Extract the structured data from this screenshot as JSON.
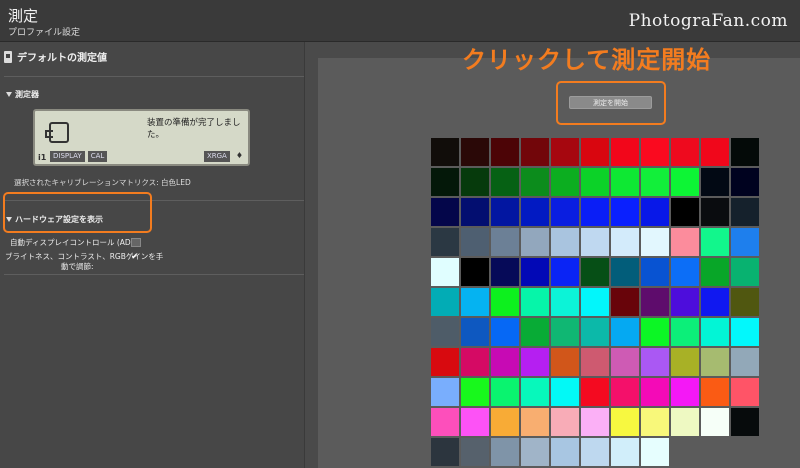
{
  "window": {
    "title": "測定",
    "subtitle": "プロファイル設定"
  },
  "watermark": "PhotograFan.com",
  "sidebar": {
    "header": "デフォルトの測定値",
    "instrument_heading": "測定器",
    "lcd_message": "装置の準備が完了しました。",
    "lcd_tags": [
      "DISPLAY",
      "CAL",
      "XRGA"
    ],
    "lcd_brand": "i1",
    "matrix_label": "選択されたキャリブレーションマトリクス:",
    "matrix_value": "白色LED",
    "hardware_heading": "ハードウェア設定を表示",
    "adc_label": "自動ディスプレイコントロール (ADC):",
    "adc_checked": false,
    "rgb_label_1": "ブライトネス、コントラスト、RGBゲインを手",
    "rgb_label_2": "動で調節:",
    "rgb_checked": true
  },
  "main": {
    "callout": "クリックして測定開始",
    "start_button": "測定を開始"
  },
  "swatches": [
    [
      "#110d0a",
      "#2a0807",
      "#4c0406",
      "#72060a",
      "#a6070f",
      "#d9060f",
      "#f2061a",
      "#fa0a1f",
      "#ee0a1e",
      "#f0071b",
      "#040a08"
    ],
    [
      "#041809",
      "#063a0c",
      "#066114",
      "#0c8c1c",
      "#0cae20",
      "#0cd228",
      "#0ee833",
      "#12ef3a",
      "#0df535",
      "#020914",
      "#00021f"
    ],
    [
      "#04064a",
      "#030e70",
      "#0216a1",
      "#021ac2",
      "#0a1ee0",
      "#0a1ef6",
      "#0a20fe",
      "#0818e8",
      "#000000",
      "#0a0c0f",
      "#15212c"
    ],
    [
      "#2b3843",
      "#4e5f71",
      "#6c8096",
      "#92a7bd",
      "#a9c4df",
      "#bfd8f0",
      "#d3ebfb",
      "#e2f7fe",
      "#fc8c9c",
      "#12f68c",
      "#1e7fed"
    ],
    [
      "#e0feff",
      "#000000",
      "#060a58",
      "#0208b6",
      "#0a24f5",
      "#064f16",
      "#025d7a",
      "#0853d2",
      "#0c6ef7",
      "#08a628",
      "#08b270"
    ],
    [
      "#02acb5",
      "#05b3f1",
      "#0df01e",
      "#06f5a9",
      "#0cf3d7",
      "#02f6fb",
      "#68040a",
      "#5e0c6c",
      "#4d0ddc",
      "#1018f0",
      "#505710"
    ],
    [
      "#4e5c68",
      "#0e58c0",
      "#0668f5",
      "#08ab36",
      "#10b773",
      "#0cb9a9",
      "#05a9f2",
      "#0cf625",
      "#0cef79",
      "#02f5d6",
      "#02f8fc"
    ],
    [
      "#d80a0f",
      "#d50a64",
      "#c70ab4",
      "#b51ff1",
      "#d1561a",
      "#ce5a70",
      "#ce5bb4",
      "#aa58f3",
      "#a8b126",
      "#a6bb70",
      "#92a8b8"
    ],
    [
      "#79aefd",
      "#18f81c",
      "#0af36f",
      "#07f8bb",
      "#02f9f6",
      "#f40a20",
      "#f4106a",
      "#f40ab7",
      "#f418f6",
      "#fa5b14",
      "#ff5467"
    ],
    [
      "#fd4fbb",
      "#fd52f6",
      "#f8ab36",
      "#f8ae70",
      "#f8acb7",
      "#fbb0f6",
      "#f7f840",
      "#f8f87a",
      "#eef9c2",
      "#f6fff8",
      "#070b0c"
    ],
    [
      "#2c353e",
      "#56616c",
      "#7f94a8",
      "#a0b4c8",
      "#a8c6e2",
      "#bed8ef",
      "#d1eefa",
      "#e6fefe",
      "",
      "",
      ""
    ]
  ]
}
